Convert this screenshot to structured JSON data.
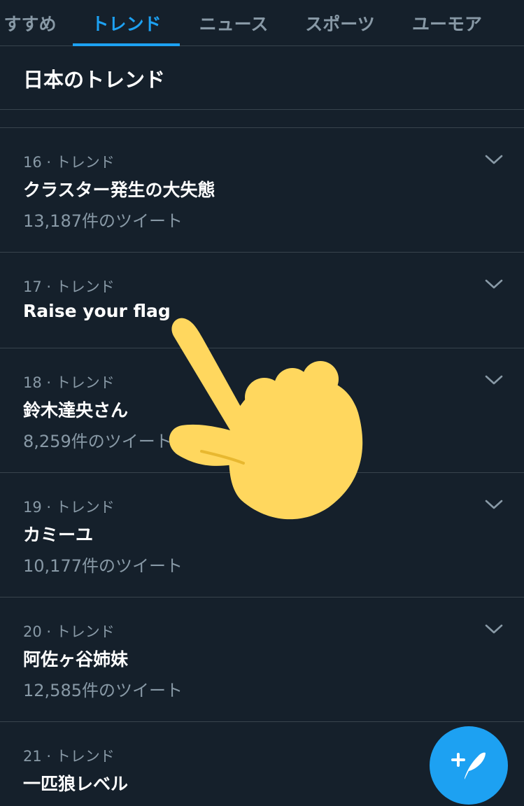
{
  "tabs": [
    {
      "label": "すすめ",
      "active": false
    },
    {
      "label": "トレンド",
      "active": true
    },
    {
      "label": "ニュース",
      "active": false
    },
    {
      "label": "スポーツ",
      "active": false
    },
    {
      "label": "ユーモア",
      "active": false
    }
  ],
  "section": {
    "title": "日本のトレンド"
  },
  "trends": [
    {
      "meta": "16 · トレンド",
      "name": "クラスター発生の大失態",
      "count": "13,187件のツイート"
    },
    {
      "meta": "17 · トレンド",
      "name": "Raise your flag",
      "count": ""
    },
    {
      "meta": "18 · トレンド",
      "name": "鈴木達央さん",
      "count": "8,259件のツイート"
    },
    {
      "meta": "19 · トレンド",
      "name": "カミーユ",
      "count": "10,177件のツイート"
    },
    {
      "meta": "20 · トレンド",
      "name": "阿佐ヶ谷姉妹",
      "count": "12,585件のツイート"
    },
    {
      "meta": "21 · トレンド",
      "name": "一匹狼レベル",
      "count": ""
    }
  ],
  "icons": {
    "chevron": "chevron-down-icon",
    "compose": "compose-tweet-icon",
    "overlay": "pointing-hand-icon"
  },
  "colors": {
    "background": "#15202b",
    "divider": "#38444d",
    "accent": "#1da1f2",
    "secondary_text": "#8899a6",
    "hand": "#ffd75e"
  }
}
